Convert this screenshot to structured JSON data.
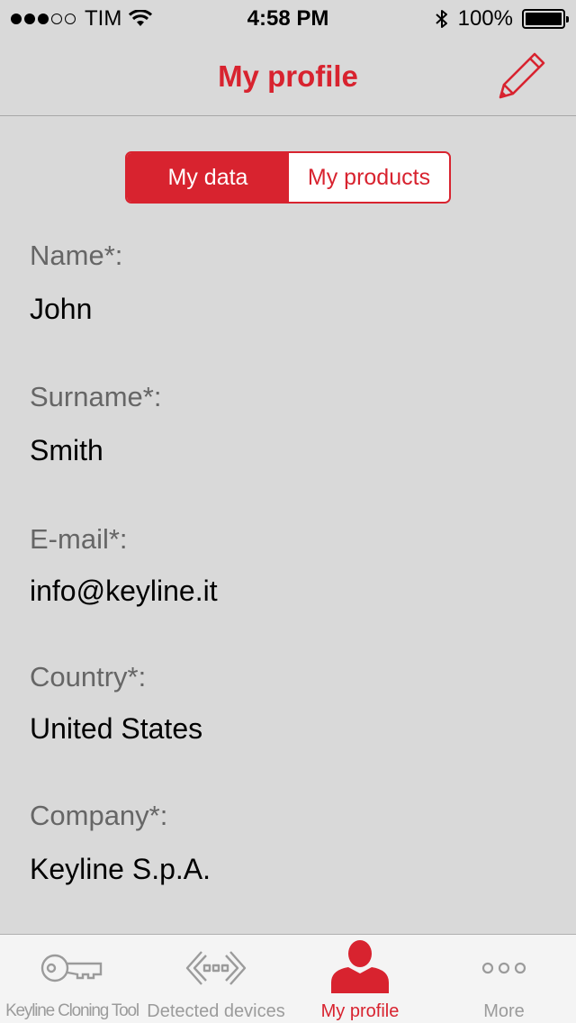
{
  "status_bar": {
    "carrier": "TIM",
    "time": "4:58 PM",
    "battery": "100%",
    "signal_strength_dots": 3,
    "signal_total_dots": 5
  },
  "nav": {
    "title": "My profile",
    "edit_icon": "pencil-icon"
  },
  "segments": {
    "active": "My data",
    "inactive": "My products"
  },
  "fields": [
    {
      "label": "Name*:",
      "value": "John"
    },
    {
      "label": "Surname*:",
      "value": "Smith"
    },
    {
      "label": "E-mail*:",
      "value": "info@keyline.it"
    },
    {
      "label": "Country*:",
      "value": "United States"
    },
    {
      "label": "Company*:",
      "value": "Keyline S.p.A."
    }
  ],
  "tabs": [
    {
      "label": "Keyline Cloning Tool",
      "icon": "key-icon"
    },
    {
      "label": "Detected devices",
      "icon": "devices-icon"
    },
    {
      "label": "My profile",
      "icon": "person-icon"
    },
    {
      "label": "More",
      "icon": "more-icon"
    }
  ],
  "colors": {
    "accent": "#d8232f",
    "background": "#d9d9d9",
    "label_gray": "#666666",
    "tab_inactive": "#9b9b9b"
  }
}
